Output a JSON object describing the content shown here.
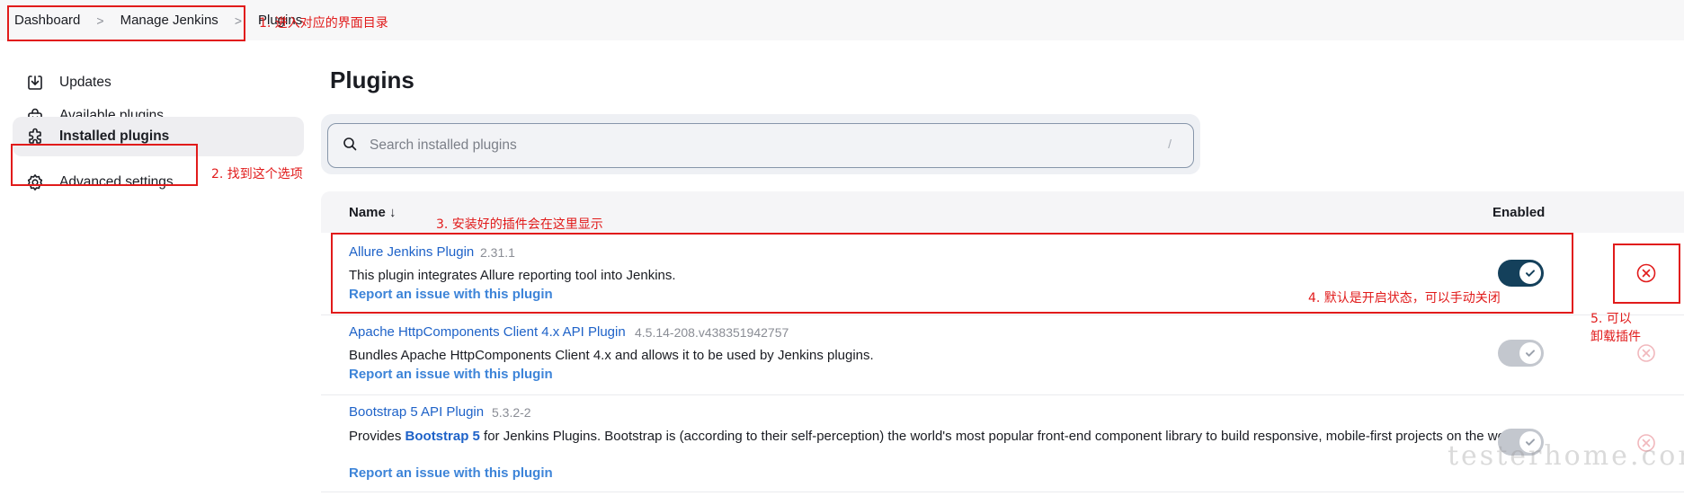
{
  "breadcrumb": {
    "items": [
      "Dashboard",
      "Manage Jenkins",
      "Plugins"
    ]
  },
  "sidebar": {
    "items": [
      {
        "label": "Updates",
        "icon": "download-icon"
      },
      {
        "label": "Available plugins",
        "icon": "shopping-bag-icon"
      },
      {
        "label": "Installed plugins",
        "icon": "puzzle-icon",
        "active": true
      },
      {
        "label": "Advanced settings",
        "icon": "gear-icon"
      }
    ]
  },
  "page": {
    "title": "Plugins"
  },
  "search": {
    "placeholder": "Search installed plugins",
    "shortcut": "/"
  },
  "table": {
    "columns": {
      "name": "Name ↓",
      "enabled": "Enabled"
    },
    "rows": [
      {
        "name": "Allure Jenkins Plugin",
        "version": "2.31.1",
        "description": "This plugin integrates Allure reporting tool into Jenkins.",
        "issue_link": "Report an issue with this plugin",
        "enabled": true,
        "toggle_editable": true
      },
      {
        "name": "Apache HttpComponents Client 4.x API Plugin",
        "version": "4.5.14-208.v438351942757",
        "description": "Bundles Apache HttpComponents Client 4.x and allows it to be used by Jenkins plugins.",
        "issue_link": "Report an issue with this plugin",
        "enabled": true,
        "toggle_editable": false
      },
      {
        "name": "Bootstrap 5 API Plugin",
        "version": "5.3.2-2",
        "description_prefix": "Provides ",
        "description_bold": "Bootstrap 5",
        "description_suffix": " for Jenkins Plugins. Bootstrap is (according to their self-perception) the world's most popular front-end component library to build responsive, mobile-first projects on the web.",
        "issue_link": "Report an issue with this plugin",
        "enabled": true,
        "toggle_editable": false
      }
    ]
  },
  "annotations": {
    "a1": "1. 进入对应的界面目录",
    "a2": "2. 找到这个选项",
    "a3": "3. 安装好的插件会在这里显示",
    "a4": "4. 默认是开启状态，可以手动关闭",
    "a5_line1": "5. 可以",
    "a5_line2": "卸载插件"
  },
  "watermark": "testerhome.com",
  "colors": {
    "annotation": "#e11b1b",
    "link": "#1e62c8",
    "toggle_on": "#14405b",
    "toggle_disabled": "#c3c7ce",
    "uninstall_active": "#e11b1b",
    "uninstall_disabled": "#f1b8bd"
  }
}
